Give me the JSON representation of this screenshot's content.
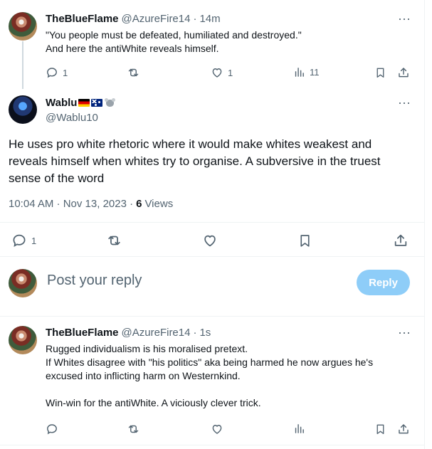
{
  "tweet1": {
    "display_name": "TheBlueFlame",
    "handle": "@AzureFire14",
    "separator": "·",
    "time": "14m",
    "text": "\"You people must be defeated, humiliated and destroyed.\"\nAnd here the antiWhite reveals himself.",
    "reply_count": "1",
    "like_count": "1",
    "views": "11"
  },
  "main_tweet": {
    "display_name": "Wablu",
    "handle": "@Wablu10",
    "badges": [
      "german-flag",
      "australian-flag",
      "koala"
    ],
    "text": "He uses pro white rhetoric where it would make whites weakest and reveals himself when whites try to organise. A subversive in the truest sense of the word",
    "timestamp": "10:04 AM · Nov 13, 2023 ·",
    "views_count": "6",
    "views_label": "Views",
    "reply_count": "1"
  },
  "composer": {
    "placeholder": "Post your reply",
    "button_label": "Reply"
  },
  "tweet2": {
    "display_name": "TheBlueFlame",
    "handle": "@AzureFire14",
    "separator": "·",
    "time": "1s",
    "text": "Rugged individualism is his moralised pretext.\nIf Whites disagree with \"his politics\" aka being harmed he now argues he's excused into inflicting harm on Westernkind.\n\nWin-win for the antiWhite. A viciously clever trick."
  },
  "more_glyph": "···",
  "colors": {
    "text": "#0f1419",
    "muted": "#536471",
    "divider": "#eff3f4",
    "reply_button": "#8ecdf8"
  }
}
